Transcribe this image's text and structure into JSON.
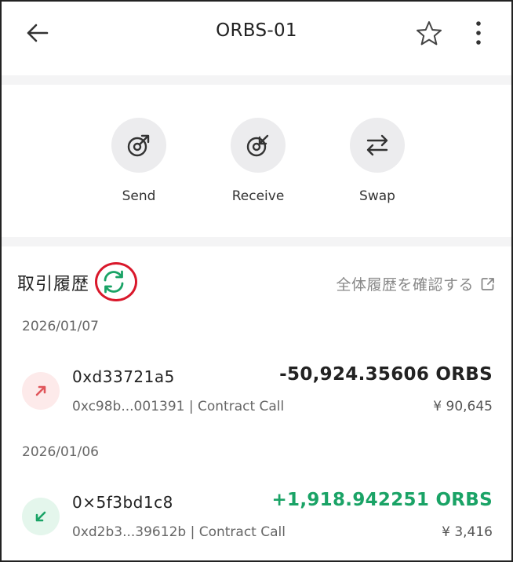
{
  "header": {
    "title": "ORBS-01",
    "back_icon": "arrow-left-icon",
    "favorite_icon": "star-outline-icon",
    "menu_icon": "more-vertical-icon"
  },
  "actions": [
    {
      "label": "Send",
      "icon": "send-icon"
    },
    {
      "label": "Receive",
      "icon": "receive-icon"
    },
    {
      "label": "Swap",
      "icon": "swap-icon"
    }
  ],
  "history": {
    "title": "取引履歴",
    "refresh_icon": "refresh-icon",
    "view_all_label": "全体履歴を確認する",
    "view_all_icon": "external-link-icon",
    "groups": [
      {
        "date": "2026/01/07",
        "transactions": [
          {
            "direction": "out",
            "name": "0xd33721a5",
            "detail": "0xc98b...001391 | Contract Call",
            "amount": "-50,924.35606 ORBS",
            "fiat": "¥ 90,645"
          }
        ]
      },
      {
        "date": "2026/01/06",
        "transactions": [
          {
            "direction": "in",
            "name": "0×5f3bd1c8",
            "detail": "0xd2b3...39612b | Contract Call",
            "amount": "+1,918.942251 ORBS",
            "fiat": "¥ 3,416"
          }
        ]
      }
    ]
  },
  "colors": {
    "negative_amount": "#222222",
    "positive_amount": "#1aa366",
    "out_icon_bg": "#fdeaea",
    "out_icon": "#e0555a",
    "in_icon_bg": "#e4f6ec",
    "in_icon": "#1aa366",
    "refresh": "#1aa366",
    "highlight_ring": "#d9182b"
  }
}
